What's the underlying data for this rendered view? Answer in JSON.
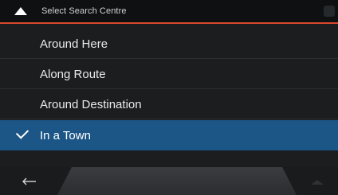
{
  "header": {
    "title": "Select Search Centre"
  },
  "options": [
    {
      "label": "Around Here",
      "selected": false
    },
    {
      "label": "Along Route",
      "selected": false
    },
    {
      "label": "Around Destination",
      "selected": false
    },
    {
      "label": "In a Town",
      "selected": true
    }
  ],
  "icons": {
    "header_back": "up-chevron-icon",
    "check": "checkmark-icon",
    "bottom_back": "back-arrow-icon"
  },
  "colors": {
    "header_accent": "#d9482b",
    "selected_row": "#1c5687",
    "background": "#1c1d1f"
  }
}
